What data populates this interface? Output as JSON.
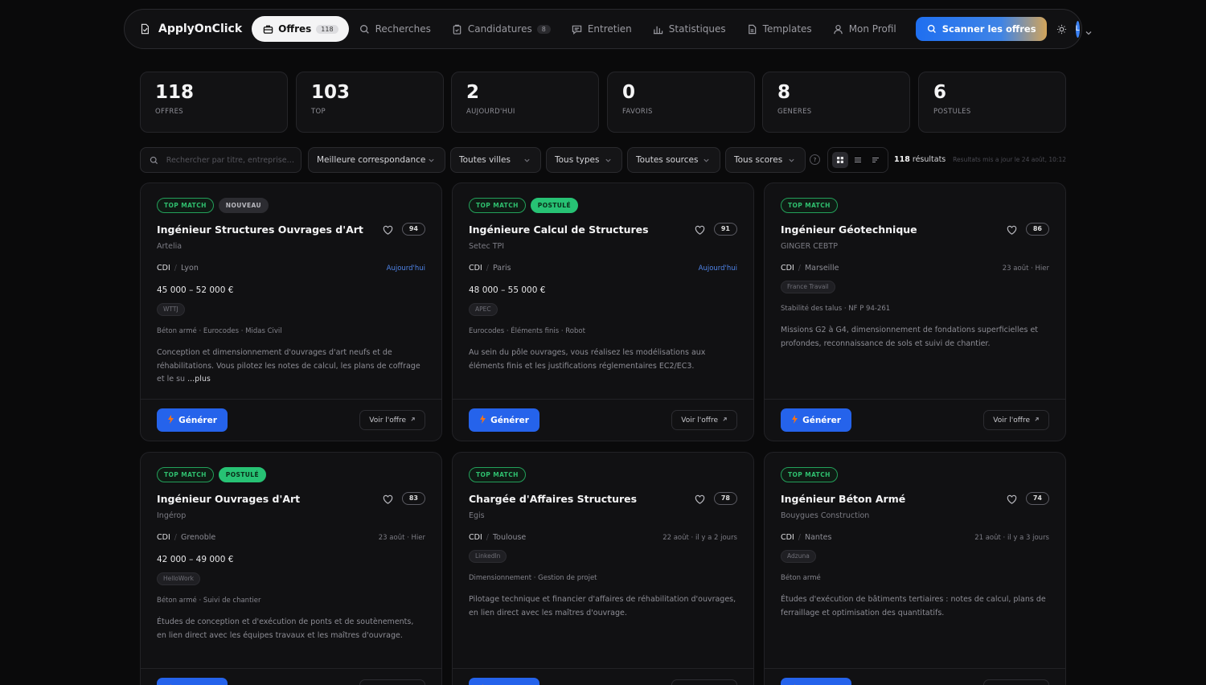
{
  "nav": {
    "brand": "ApplyOnClick",
    "items": [
      {
        "label": "Offres",
        "badge": "118",
        "icon": "briefcase-icon"
      },
      {
        "label": "Recherches",
        "icon": "search-icon"
      },
      {
        "label": "Candidatures",
        "badge": "8",
        "icon": "clipboard-icon"
      },
      {
        "label": "Entretien",
        "icon": "chat-icon"
      },
      {
        "label": "Statistiques",
        "icon": "bar-chart-icon"
      },
      {
        "label": "Templates",
        "icon": "document-icon"
      },
      {
        "label": "Mon Profil",
        "icon": "user-icon"
      }
    ],
    "scan_label": "Scanner les offres",
    "avatar": "L"
  },
  "stats": [
    {
      "value": "118",
      "label": "OFFRES"
    },
    {
      "value": "103",
      "label": "TOP"
    },
    {
      "value": "2",
      "label": "AUJOURD'HUI"
    },
    {
      "value": "0",
      "label": "FAVORIS"
    },
    {
      "value": "8",
      "label": "GENERES"
    },
    {
      "value": "6",
      "label": "POSTULES"
    }
  ],
  "filters": {
    "search_placeholder": "Rechercher par titre, entreprise…",
    "sort": "Meilleure correspondance",
    "city": "Toutes villes",
    "type": "Tous types",
    "source": "Toutes sources",
    "score": "Tous scores",
    "help": "?",
    "results_count": "118",
    "results_label": "résultats",
    "updated": "Resultats mis a jour le 24 août, 10:12"
  },
  "cards": [
    {
      "tags": [
        {
          "label": "TOP MATCH",
          "kind": "top"
        },
        {
          "label": "NOUVEAU",
          "kind": "new"
        }
      ],
      "title": "Ingénieur Structures Ouvrages d'Art",
      "score": "94",
      "company": "Artelia",
      "contract": "CDI",
      "city": "Lyon",
      "date": "Aujourd'hui",
      "date_today": true,
      "salary": "45 000 – 52 000 €",
      "source": "WTTJ",
      "skills": "Béton armé · Eurocodes · Midas Civil",
      "description": "Conception et dimensionnement d'ouvrages d'art neufs et de réhabilitations. Vous pilotez les notes de calcul, les plans de coffrage et le su",
      "more": "...plus"
    },
    {
      "tags": [
        {
          "label": "TOP MATCH",
          "kind": "top"
        },
        {
          "label": "POSTULÉ",
          "kind": "applied"
        }
      ],
      "title": "Ingénieure Calcul de Structures",
      "score": "91",
      "company": "Setec TPI",
      "contract": "CDI",
      "city": "Paris",
      "date": "Aujourd'hui",
      "date_today": true,
      "salary": "48 000 – 55 000 €",
      "source": "APEC",
      "skills": "Eurocodes · Éléments finis · Robot",
      "description": "Au sein du pôle ouvrages, vous réalisez les modélisations aux éléments finis et les justifications réglementaires EC2/EC3.",
      "more": ""
    },
    {
      "tags": [
        {
          "label": "TOP MATCH",
          "kind": "top"
        }
      ],
      "title": "Ingénieur Géotechnique",
      "score": "86",
      "company": "GINGER CEBTP",
      "contract": "CDI",
      "city": "Marseille",
      "date": "23 août · Hier",
      "date_today": false,
      "salary": "",
      "source": "France Travail",
      "skills": "Stabilité des talus · NF P 94-261",
      "description": "Missions G2 à G4, dimensionnement de fondations superficielles et profondes, reconnaissance de sols et suivi de chantier.",
      "more": ""
    },
    {
      "tags": [
        {
          "label": "TOP MATCH",
          "kind": "top"
        },
        {
          "label": "POSTULÉ",
          "kind": "applied"
        }
      ],
      "title": "Ingénieur Ouvrages d'Art",
      "score": "83",
      "company": "Ingérop",
      "contract": "CDI",
      "city": "Grenoble",
      "date": "23 août · Hier",
      "date_today": false,
      "salary": "42 000 – 49 000 €",
      "source": "HelloWork",
      "skills": "Béton armé · Suivi de chantier",
      "description": "Études de conception et d'exécution de ponts et de soutènements, en lien direct avec les équipes travaux et les maîtres d'ouvrage.",
      "more": ""
    },
    {
      "tags": [
        {
          "label": "TOP MATCH",
          "kind": "top"
        }
      ],
      "title": "Chargée d'Affaires Structures",
      "score": "78",
      "company": "Egis",
      "contract": "CDI",
      "city": "Toulouse",
      "date": "22 août · il y a 2 jours",
      "date_today": false,
      "salary": "",
      "source": "LinkedIn",
      "skills": "Dimensionnement · Gestion de projet",
      "description": "Pilotage technique et financier d'affaires de réhabilitation d'ouvrages, en lien direct avec les maîtres d'ouvrage.",
      "more": ""
    },
    {
      "tags": [
        {
          "label": "TOP MATCH",
          "kind": "top"
        }
      ],
      "title": "Ingénieur Béton Armé",
      "score": "74",
      "company": "Bouygues Construction",
      "contract": "CDI",
      "city": "Nantes",
      "date": "21 août · il y a 3 jours",
      "date_today": false,
      "salary": "",
      "source": "Adzuna",
      "skills": "Béton armé",
      "description": "Études d'exécution de bâtiments tertiaires : notes de calcul, plans de ferraillage et optimisation des quantitatifs.",
      "more": ""
    }
  ],
  "card_actions": {
    "generate": "Générer",
    "view": "Voir l'offre"
  },
  "colors": {
    "accent": "#2563eb",
    "top_match": "#2fbf6e",
    "applied": "#27c274",
    "today": "#4f84e8"
  }
}
